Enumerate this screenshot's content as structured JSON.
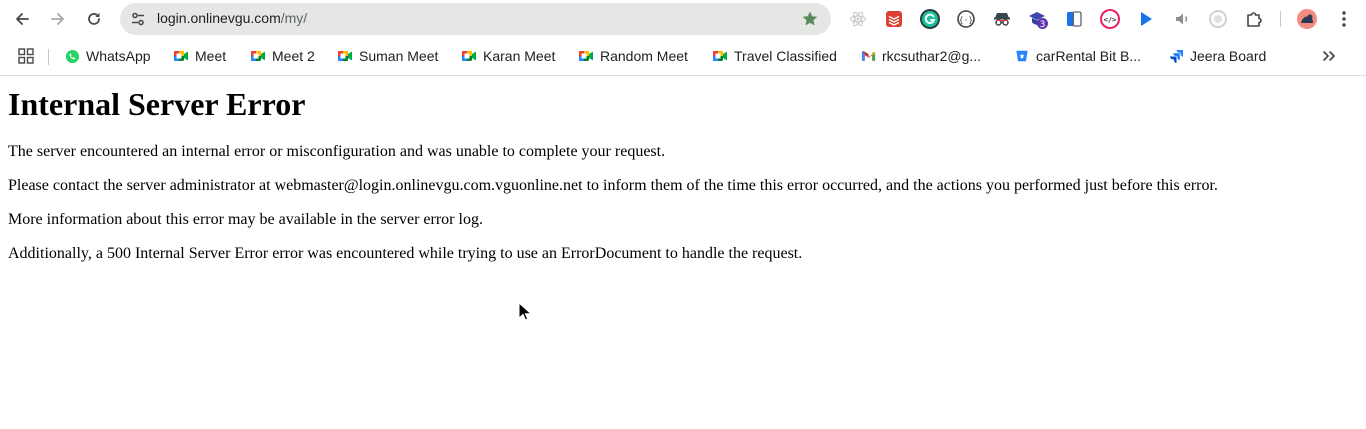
{
  "browser": {
    "url_domain": "login.onlinevgu.com",
    "url_path": "/my/",
    "extensions": [
      {
        "name": "react-devtools-icon"
      },
      {
        "name": "todoist-icon"
      },
      {
        "name": "grammarly-icon"
      },
      {
        "name": "json-viewer-icon"
      },
      {
        "name": "incognito-spy-icon"
      },
      {
        "name": "hat-extension-icon",
        "badge": "3"
      },
      {
        "name": "phone-mirror-icon"
      },
      {
        "name": "code-tag-icon"
      },
      {
        "name": "cursor-arrow-icon"
      },
      {
        "name": "speaker-icon"
      },
      {
        "name": "record-icon"
      },
      {
        "name": "puzzle-piece-icon"
      }
    ]
  },
  "bookmarks": [
    {
      "label": "WhatsApp",
      "icon": "whatsapp-icon"
    },
    {
      "label": "Meet",
      "icon": "google-meet-icon"
    },
    {
      "label": "Meet 2",
      "icon": "google-meet-icon"
    },
    {
      "label": "Suman Meet",
      "icon": "google-meet-icon"
    },
    {
      "label": "Karan Meet",
      "icon": "google-meet-icon"
    },
    {
      "label": "Random Meet",
      "icon": "google-meet-icon"
    },
    {
      "label": "Travel Classified",
      "icon": "google-meet-icon"
    },
    {
      "label": "rkcsuthar2@g...",
      "icon": "gmail-icon"
    },
    {
      "label": "carRental Bit B...",
      "icon": "bitbucket-icon"
    },
    {
      "label": "Jeera Board",
      "icon": "jira-icon"
    }
  ],
  "page": {
    "title": "Internal Server Error",
    "paragraphs": [
      "The server encountered an internal error or misconfiguration and was unable to complete your request.",
      "Please contact the server administrator at webmaster@login.onlinevgu.com.vguonline.net to inform them of the time this error occurred, and the actions you performed just before this error.",
      "More information about this error may be available in the server error log.",
      "Additionally, a 500 Internal Server Error error was encountered while trying to use an ErrorDocument to handle the request."
    ]
  },
  "colors": {
    "omnibox_bg": "#e4e7e4",
    "star": "#5b8a5e",
    "meet_green": "#00832d",
    "whatsapp": "#25d366"
  }
}
